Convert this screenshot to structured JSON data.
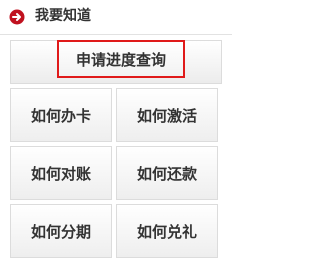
{
  "header": {
    "title": "我要知道",
    "icon": "circle-arrow-right-icon",
    "icon_color": "#c0111f"
  },
  "query_button": {
    "label": "申请进度查询",
    "border_color": "#e01a1a"
  },
  "grid_items": [
    {
      "label": "如何办卡"
    },
    {
      "label": "如何激活"
    },
    {
      "label": "如何对账"
    },
    {
      "label": "如何还款"
    },
    {
      "label": "如何分期"
    },
    {
      "label": "如何兑礼"
    }
  ]
}
